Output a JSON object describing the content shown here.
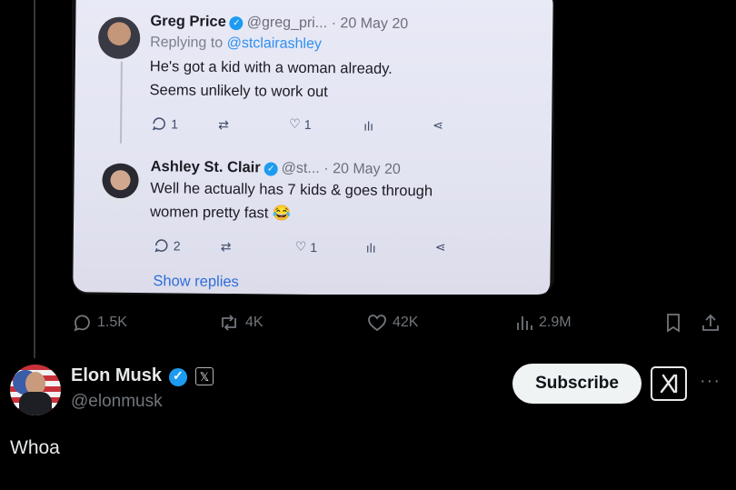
{
  "embedded_screenshot": {
    "reply1": {
      "name": "Greg Price",
      "handle": "@greg_pri...",
      "date": "· 20 May 20",
      "replying_prefix": "Replying to ",
      "replying_handle": "@stclairashley",
      "text_line1": "He's got a kid with a woman already.",
      "text_line2": "Seems unlikely to work out",
      "replies": "1",
      "likes": "1"
    },
    "reply2": {
      "name": "Ashley St. Clair",
      "handle": "@st...",
      "date": "· 20 May 20",
      "text_line1": "Well he actually has 7 kids & goes through",
      "text_line2": "women pretty fast 😂",
      "replies": "2",
      "likes": "1"
    },
    "show_replies": "Show replies"
  },
  "actions": {
    "replies": "1.5K",
    "reposts": "4K",
    "likes": "42K",
    "views": "2.9M"
  },
  "author": {
    "name": "Elon Musk",
    "handle": "@elonmusk",
    "subscribe_label": "Subscribe",
    "more": "···"
  },
  "tweet_text": "Whoa",
  "colors": {
    "background": "#000000",
    "muted": "#71767b",
    "verified": "#1d9bf0"
  }
}
